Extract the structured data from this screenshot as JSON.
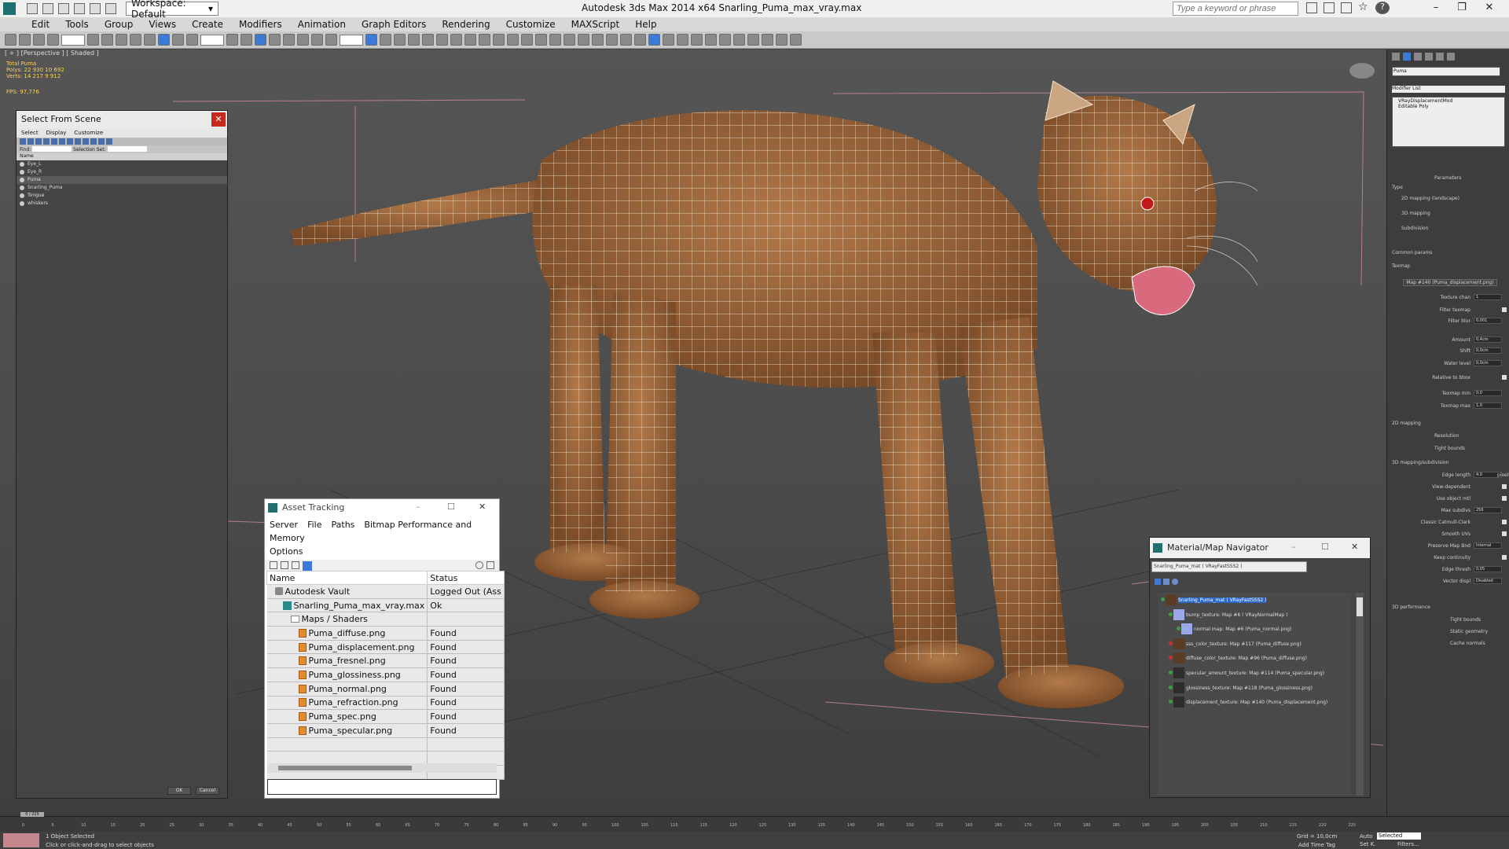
{
  "titlebar": {
    "workspace": "Workspace: Default",
    "app_title": "Autodesk 3ds Max  2014 x64     Snarling_Puma_max_vray.max",
    "search_placeholder": "Type a keyword or phrase"
  },
  "menu": [
    "Edit",
    "Tools",
    "Group",
    "Views",
    "Create",
    "Modifiers",
    "Animation",
    "Graph Editors",
    "Rendering",
    "Customize",
    "MAXScript",
    "Help"
  ],
  "viewport": {
    "label": "[ + ] [Perspective ] [ Shaded ]",
    "stats": {
      "header": "Total    Puma",
      "polys": "Polys:  22 930    10 692",
      "verts": "Verts:  14 217    9 912",
      "fps": "FPS:    97,776"
    }
  },
  "select_from_scene": {
    "title": "Select From Scene",
    "menu": [
      "Select",
      "Display",
      "Customize"
    ],
    "find_label": "Find:",
    "selection_set": "Selection Set:",
    "col_name": "Name",
    "items": [
      "Eye_L",
      "Eye_R",
      "Puma",
      "Snarling_Puma",
      "Tongue",
      "whiskers"
    ],
    "selected_index": 2,
    "ok": "OK",
    "cancel": "Cancel"
  },
  "asset_tracking": {
    "title": "Asset Tracking",
    "menu": [
      "Server",
      "File",
      "Paths",
      "Bitmap Performance and Memory",
      "Options"
    ],
    "col_name": "Name",
    "col_status": "Status",
    "rows": [
      {
        "name": "Autodesk Vault",
        "status": "Logged Out (Ass",
        "indent": 1,
        "icon": "vault-icon"
      },
      {
        "name": "Snarling_Puma_max_vray.max",
        "status": "Ok",
        "indent": 2,
        "icon": "max-file-icon"
      },
      {
        "name": "Maps / Shaders",
        "status": "",
        "indent": 3,
        "icon": "folder-icon"
      },
      {
        "name": "Puma_diffuse.png",
        "status": "Found",
        "indent": 4,
        "icon": "image-file-icon"
      },
      {
        "name": "Puma_displacement.png",
        "status": "Found",
        "indent": 4,
        "icon": "image-file-icon"
      },
      {
        "name": "Puma_fresnel.png",
        "status": "Found",
        "indent": 4,
        "icon": "image-file-icon"
      },
      {
        "name": "Puma_glossiness.png",
        "status": "Found",
        "indent": 4,
        "icon": "image-file-icon"
      },
      {
        "name": "Puma_normal.png",
        "status": "Found",
        "indent": 4,
        "icon": "image-file-icon"
      },
      {
        "name": "Puma_refraction.png",
        "status": "Found",
        "indent": 4,
        "icon": "image-file-icon"
      },
      {
        "name": "Puma_spec.png",
        "status": "Found",
        "indent": 4,
        "icon": "image-file-icon"
      },
      {
        "name": "Puma_specular.png",
        "status": "Found",
        "indent": 4,
        "icon": "image-file-icon"
      }
    ]
  },
  "material_navigator": {
    "title": "Material/Map Navigator",
    "current": "Snarling_Puma_mat  ( VRayFastSSS2 )",
    "items": [
      {
        "label": "Snarling_Puma_mat  ( VRayFastSSS2 )",
        "selected": true,
        "thumb": "brown"
      },
      {
        "label": "bump_texture: Map #6  ( VRayNormalMap )",
        "selected": false,
        "thumb": "blue"
      },
      {
        "label": "normal map: Map #6 (Puma_normal.png)",
        "selected": false,
        "thumb": "blue"
      },
      {
        "label": "sss_color_texture: Map #117 (Puma_diffuse.png)",
        "selected": false,
        "thumb": "brown"
      },
      {
        "label": "diffuse_color_texture: Map #96 (Puma_diffuse.png)",
        "selected": false,
        "thumb": "brown"
      },
      {
        "label": "specular_amount_texture: Map #114 (Puma_specular.png)",
        "selected": false,
        "thumb": "dark"
      },
      {
        "label": "glossiness_texture: Map #118 (Puma_glossiness.png)",
        "selected": false,
        "thumb": "dark"
      },
      {
        "label": "displacement_texture: Map #140 (Puma_displacement.png)",
        "selected": false,
        "thumb": "dark"
      }
    ]
  },
  "command_panel": {
    "object_name": "Puma",
    "modifier_list": "Modifier List",
    "stack": [
      "VRayDisplacementMod",
      "Editable Poly"
    ],
    "parameters": "Parameters",
    "type_label": "Type",
    "types": [
      "2D mapping (landscape)",
      "3D mapping",
      "Subdivision"
    ],
    "common_params": "Common params",
    "texmap_label": "Texmap",
    "texmap": "Map #140 (Puma_displacement.png)",
    "rows": [
      {
        "label": "Texture chan",
        "value": "1"
      },
      {
        "label": "Filter texmap",
        "value": ""
      },
      {
        "label": "Filter blur",
        "value": "0,001"
      },
      {
        "label": "Amount",
        "value": "0,4cm"
      },
      {
        "label": "Shift",
        "value": "0,0cm"
      },
      {
        "label": "Water level",
        "value": "0,0cm"
      },
      {
        "label": "Relative to bbox",
        "value": ""
      },
      {
        "label": "Texmap min",
        "value": "0,0"
      },
      {
        "label": "Texmap max",
        "value": "1,0"
      }
    ],
    "mapping2d": "2D mapping",
    "resolution": "Resolution",
    "tight_bounds": "Tight bounds",
    "mapping3d": "3D mapping/subdivision",
    "rows3d": [
      {
        "label": "Edge length",
        "value": "4,0",
        "suffix": "pixels"
      },
      {
        "label": "View-dependent",
        "value": ""
      },
      {
        "label": "Use object mtl",
        "value": ""
      },
      {
        "label": "Max subdivs",
        "value": "256"
      },
      {
        "label": "Classic Catmull-Clark",
        "value": ""
      },
      {
        "label": "Smooth UVs",
        "value": ""
      },
      {
        "label": "Preserve Map Bnd",
        "value": "Internal"
      },
      {
        "label": "Keep continuity",
        "value": ""
      },
      {
        "label": "Edge thresh",
        "value": "0,05"
      },
      {
        "label": "Vector displ",
        "value": "Disabled"
      }
    ],
    "performance": "3D performance",
    "perf": [
      "Tight bounds",
      "Static geometry",
      "Cache normals"
    ]
  },
  "timeline": {
    "frame": "0 / 225",
    "ticks": [
      "0",
      "5",
      "10",
      "15",
      "20",
      "25",
      "30",
      "35",
      "40",
      "45",
      "50",
      "55",
      "60",
      "65",
      "70",
      "75",
      "80",
      "85",
      "90",
      "95",
      "100",
      "105",
      "110",
      "115",
      "120",
      "125",
      "130",
      "135",
      "140",
      "145",
      "150",
      "155",
      "160",
      "165",
      "170",
      "175",
      "180",
      "185",
      "190",
      "195",
      "200",
      "205",
      "210",
      "215",
      "220",
      "225"
    ]
  },
  "status": {
    "selection": "1 Object Selected",
    "hint": "Click or click-and-drag to select objects",
    "grid": "Grid = 10,0cm",
    "auto": "Auto",
    "selected": "Selected",
    "set_key": "Set K.",
    "filters": "Filters...",
    "add_time_tag": "Add Time Tag"
  },
  "colors": {
    "fur": "#a0683c",
    "wire": "#f5e6d2",
    "selection_blue": "#2e69c9",
    "close_red": "#c42b1c"
  }
}
